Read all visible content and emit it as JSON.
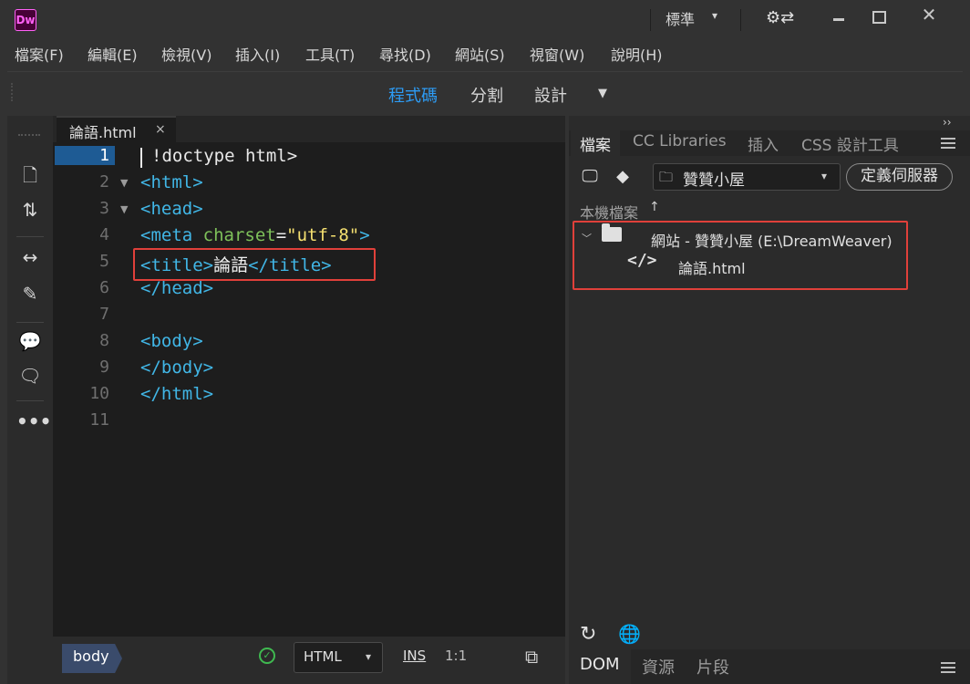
{
  "window": {
    "app_logo": "Dw",
    "workspace": "標準",
    "controls": {
      "close": "✕"
    }
  },
  "menu": [
    "檔案(F)",
    "編輯(E)",
    "檢視(V)",
    "插入(I)",
    "工具(T)",
    "尋找(D)",
    "網站(S)",
    "視窗(W)",
    "說明(H)"
  ],
  "view_switcher": {
    "buttons": [
      "程式碼",
      "分割",
      "設計"
    ],
    "active": "程式碼"
  },
  "left_toolbar_icons": [
    "new-document-icon",
    "file-transfer-icon",
    "expand-icon",
    "format-source-icon",
    "comment-icon",
    "remove-comment-icon",
    "more-icon"
  ],
  "document": {
    "tab_label": "論語.html",
    "tab_close": "×",
    "current_line": 1,
    "line_numbers": [
      "1",
      "2",
      "3",
      "4",
      "5",
      "6",
      "7",
      "8",
      "9",
      "10",
      "11"
    ],
    "code": {
      "l1": "!doctype html>",
      "l1_lt": "<",
      "l2": "<html>",
      "l3": "<head>",
      "l4_tag_open": "<meta ",
      "l4_attr": "charset",
      "l4_eq": "=",
      "l4_val": "\"utf-8\"",
      "l4_close": ">",
      "l5_open": "<title>",
      "l5_text": "論語",
      "l5_close": "</title>",
      "l6": "</head>",
      "l8": "<body>",
      "l9": "</body>",
      "l10": "</html>"
    }
  },
  "status_bar": {
    "tag": "body",
    "doctype": "HTML",
    "mode": "INS",
    "position": "1:1",
    "lint_ok": "✓"
  },
  "right_panel": {
    "collapse": "››",
    "tabs": [
      "檔案",
      "CC Libraries",
      "插入",
      "CSS 設計工具"
    ],
    "active_tab": "檔案",
    "site_select": "贊贊小屋",
    "define_server": "定義伺服器",
    "local_files": "本機檔案",
    "sort_arrow": "↑",
    "tree": {
      "site": "網站 - 贊贊小屋 (E:\\DreamWeaver)",
      "file": "論語.html",
      "code_icon_text": "</>"
    },
    "bottom_tabs": [
      "DOM",
      "資源",
      "片段"
    ],
    "active_bottom_tab": "DOM"
  }
}
